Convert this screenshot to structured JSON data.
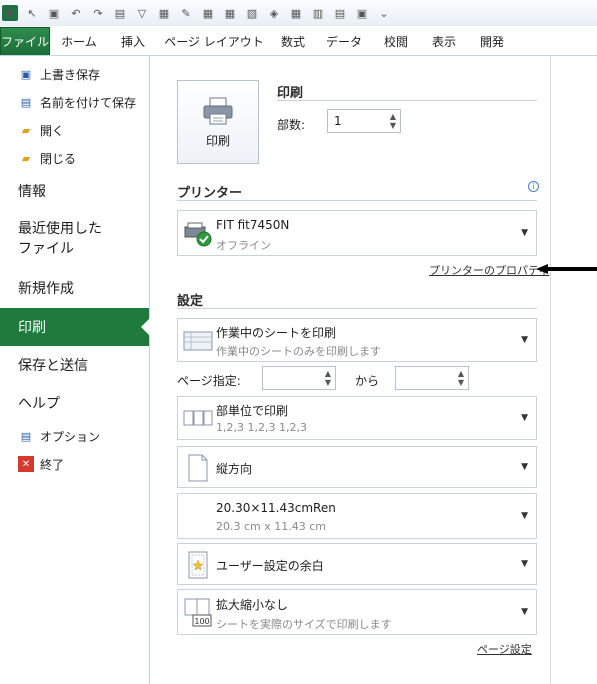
{
  "tabs": {
    "file": "ファイル",
    "items": [
      "ホーム",
      "挿入",
      "ページ レイアウト",
      "数式",
      "データ",
      "校閲",
      "表示",
      "開発"
    ]
  },
  "sidebar": {
    "save": "上書き保存",
    "save_as": "名前を付けて保存",
    "open": "開く",
    "close": "閉じる",
    "info": "情報",
    "recent_line1": "最近使用した",
    "recent_line2": "ファイル",
    "new": "新規作成",
    "print": "印刷",
    "save_send": "保存と送信",
    "help": "ヘルプ",
    "options": "オプション",
    "exit": "終了"
  },
  "print": {
    "button_label": "印刷",
    "heading": "印刷",
    "copies_label": "部数:",
    "copies_value": "1"
  },
  "printer": {
    "heading": "プリンター",
    "name": "FIT fit7450N",
    "status": "オフライン",
    "properties_link": "プリンターのプロパティ"
  },
  "settings": {
    "heading": "設定",
    "scope_title": "作業中のシートを印刷",
    "scope_desc": "作業中のシートのみを印刷します",
    "pages_label": "ページ指定:",
    "pages_to": "から",
    "collate_title": "部単位で印刷",
    "collate_desc": "1,2,3    1,2,3    1,2,3",
    "orientation": "縦方向",
    "paper_title": "20.30×11.43cmRen",
    "paper_desc": "20.3 cm x 11.43 cm",
    "margins": "ユーザー設定の余白",
    "scaling_title": "拡大縮小なし",
    "scaling_desc": "シートを実際のサイズで印刷します",
    "page_setup_link": "ページ設定"
  },
  "colors": {
    "accent_green": "#1f7a3d"
  }
}
